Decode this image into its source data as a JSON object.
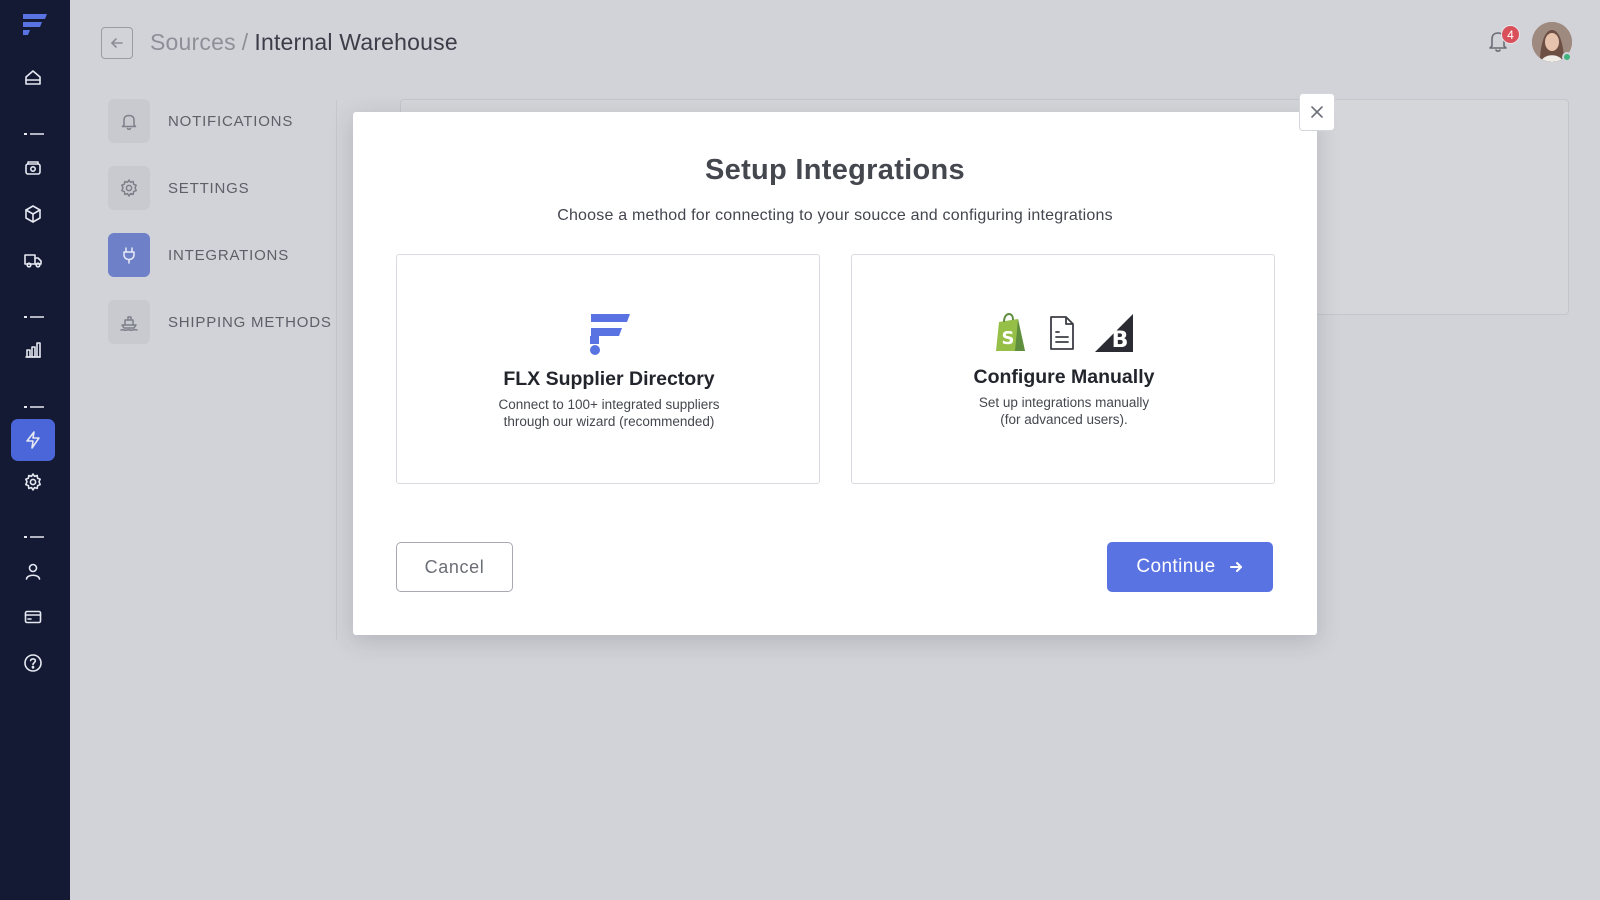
{
  "app": {
    "brand_color": "#5a73e2",
    "rail_background": "#141a33"
  },
  "rail": {
    "items": [
      {
        "icon": "home-icon"
      },
      {
        "icon": "menu-separator"
      },
      {
        "icon": "payments-icon"
      },
      {
        "icon": "box-icon"
      },
      {
        "icon": "truck-icon"
      },
      {
        "icon": "menu-separator"
      },
      {
        "icon": "bar-chart-icon"
      },
      {
        "icon": "menu-separator"
      },
      {
        "icon": "lightning-icon",
        "active": true
      },
      {
        "icon": "gear-icon"
      },
      {
        "icon": "menu-separator"
      },
      {
        "icon": "user-icon"
      },
      {
        "icon": "credit-card-icon"
      },
      {
        "icon": "help-icon"
      }
    ]
  },
  "header": {
    "breadcrumb_parent": "Sources",
    "breadcrumb_separator": "/",
    "breadcrumb_current": "Internal Warehouse",
    "notification_count": "4"
  },
  "subnav": {
    "items": [
      {
        "label": "NOTIFICATIONS",
        "icon": "bell-icon"
      },
      {
        "label": "SETTINGS",
        "icon": "gear-icon"
      },
      {
        "label": "INTEGRATIONS",
        "icon": "plug-icon",
        "active": true
      },
      {
        "label": "SHIPPING METHODS",
        "icon": "ship-icon"
      }
    ]
  },
  "modal": {
    "title": "Setup Integrations",
    "subtitle": "Choose a method for connecting to your soucce and configuring integrations",
    "options": [
      {
        "title": "FLX Supplier Directory",
        "desc_line1": "Connect to 100+ integrated suppliers",
        "desc_line2": "through our wizard (recommended)",
        "icon": "flx-logo"
      },
      {
        "title": "Configure Manually",
        "desc_line1": "Set up integrations manually",
        "desc_line2": "(for advanced users).",
        "icons": [
          "shopify-icon",
          "document-icon",
          "bigcommerce-icon"
        ]
      }
    ],
    "cancel_label": "Cancel",
    "continue_label": "Continue"
  }
}
